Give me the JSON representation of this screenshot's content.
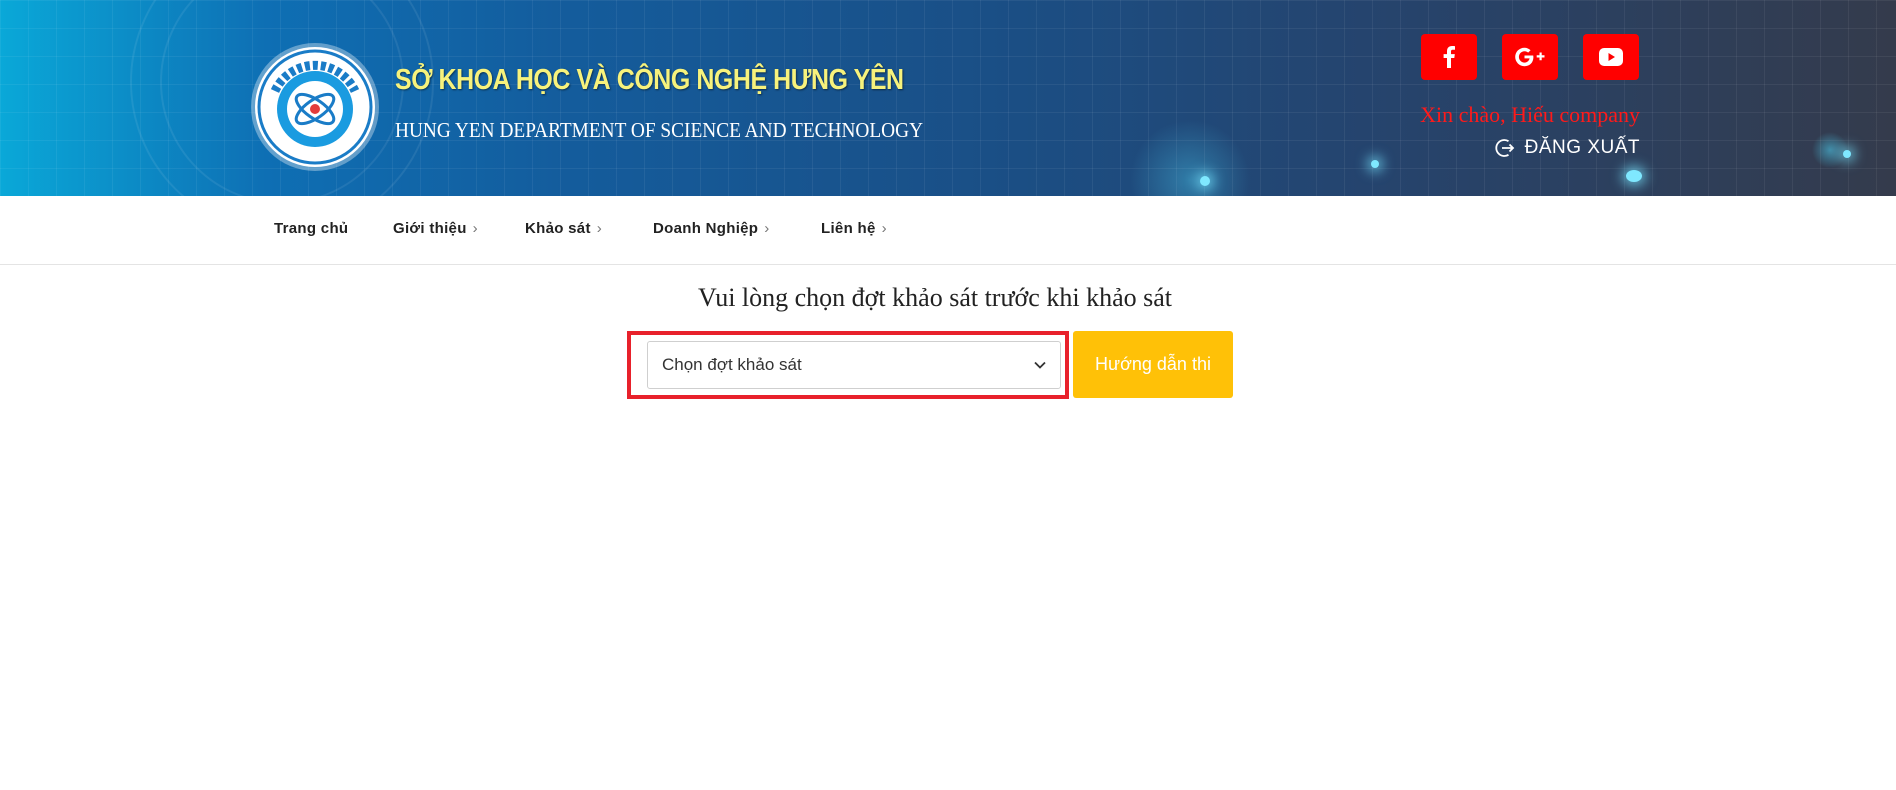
{
  "header": {
    "org_name_vn": "SỞ KHOA HỌC VÀ CÔNG NGHỆ HƯNG YÊN",
    "org_name_en": "HUNG YEN DEPARTMENT OF SCIENCE AND TECHNOLOGY",
    "logo_text": "KHOA HỌC VÀ CÔNG NGHỆ",
    "social": [
      {
        "name": "facebook",
        "icon": "facebook-icon"
      },
      {
        "name": "google-plus",
        "icon": "google-plus-icon"
      },
      {
        "name": "youtube",
        "icon": "youtube-icon"
      }
    ],
    "greeting": "Xin chào, Hiếu company",
    "logout_label": "ĐĂNG XUẤT",
    "logout_icon": "logout-icon"
  },
  "nav": {
    "items": [
      {
        "label": "Trang chủ",
        "has_submenu": false
      },
      {
        "label": "Giới thiệu",
        "has_submenu": true
      },
      {
        "label": "Khảo sát",
        "has_submenu": true
      },
      {
        "label": "Doanh Nghiệp",
        "has_submenu": true
      },
      {
        "label": "Liên hệ",
        "has_submenu": true
      }
    ]
  },
  "main": {
    "prompt": "Vui lòng chọn đợt khảo sát trước khi khảo sát",
    "survey_select": {
      "selected": "Chọn đợt khảo sát"
    },
    "guide_button": "Hướng dẫn thi"
  },
  "colors": {
    "social_bg": "#ff0000",
    "greeting": "#ff1a1a",
    "highlight_border": "#e8212b",
    "guide_button_bg": "#ffc107"
  }
}
